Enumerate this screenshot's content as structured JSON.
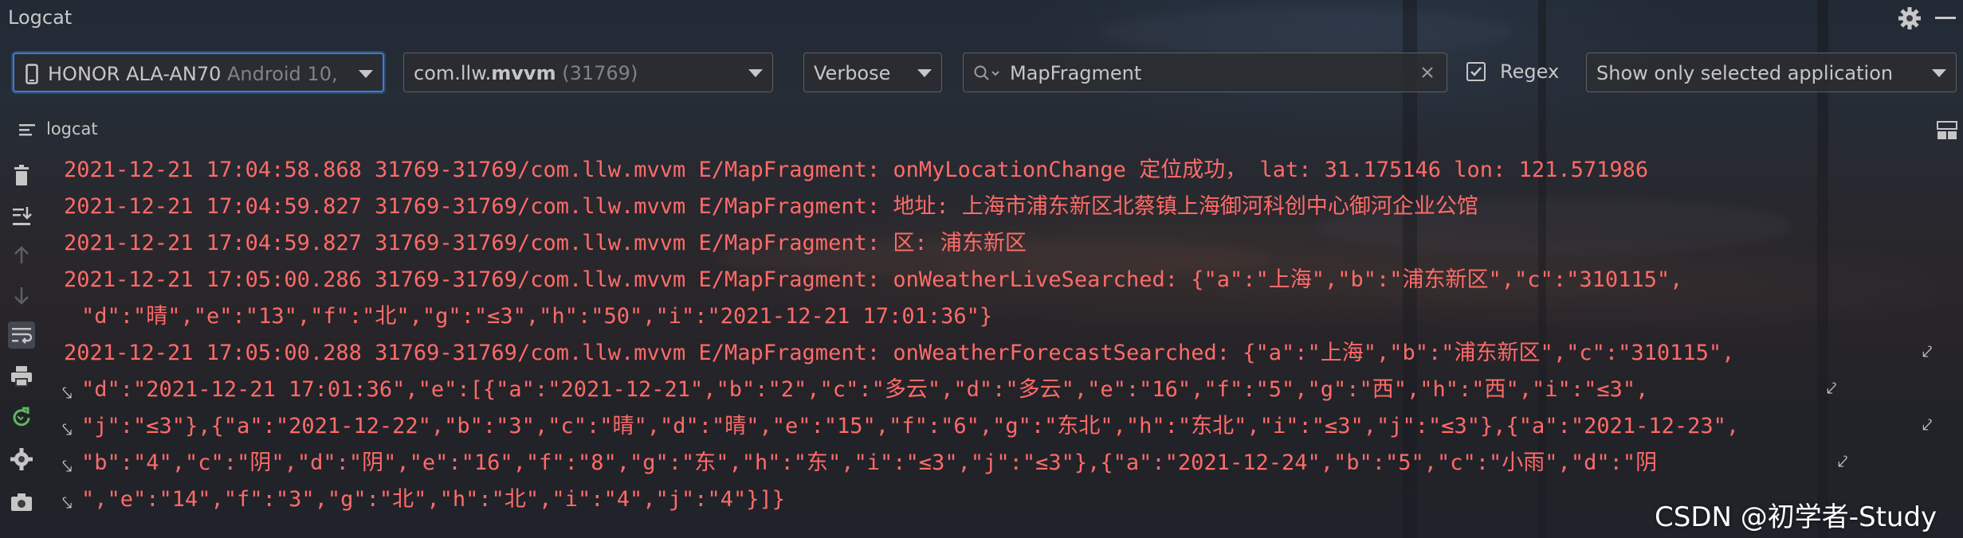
{
  "window": {
    "title": "Logcat"
  },
  "toolbar": {
    "device": {
      "name": "HONOR ALA-AN70",
      "os": "Android 10,"
    },
    "process": {
      "prefix": "com.llw.",
      "bold": "mvvm",
      "pid": "(31769)"
    },
    "level": "Verbose",
    "search": {
      "value": "MapFragment"
    },
    "regex": {
      "label": "Regex",
      "checked": true
    },
    "filter": "Show only selected application"
  },
  "panel": {
    "label": "logcat"
  },
  "sidebar": {
    "tools": [
      "trash-icon",
      "scroll-to-end-icon",
      "up-arrow-icon",
      "down-arrow-icon",
      "soft-wrap-icon",
      "print-icon",
      "restart-icon",
      "settings-icon",
      "camera-icon"
    ]
  },
  "log": {
    "lines": [
      "2021-12-21 17:04:58.868 31769-31769/com.llw.mvvm E/MapFragment: onMyLocationChange 定位成功， lat: 31.175146 lon: 121.571986",
      "2021-12-21 17:04:59.827 31769-31769/com.llw.mvvm E/MapFragment: 地址: 上海市浦东新区北蔡镇上海御河科创中心御河企业公馆",
      "2021-12-21 17:04:59.827 31769-31769/com.llw.mvvm E/MapFragment: 区: 浦东新区",
      "2021-12-21 17:05:00.286 31769-31769/com.llw.mvvm E/MapFragment: onWeatherLiveSearched: {\"a\":\"上海\",\"b\":\"浦东新区\",\"c\":\"310115\",",
      "\"d\":\"晴\",\"e\":\"13\",\"f\":\"北\",\"g\":\"≤3\",\"h\":\"50\",\"i\":\"2021-12-21 17:01:36\"}",
      "2021-12-21 17:05:00.288 31769-31769/com.llw.mvvm E/MapFragment: onWeatherForecastSearched: {\"a\":\"上海\",\"b\":\"浦东新区\",\"c\":\"310115\",",
      "\"d\":\"2021-12-21 17:01:36\",\"e\":[{\"a\":\"2021-12-21\",\"b\":\"2\",\"c\":\"多云\",\"d\":\"多云\",\"e\":\"16\",\"f\":\"5\",\"g\":\"西\",\"h\":\"西\",\"i\":\"≤3\",",
      "\"j\":\"≤3\"},{\"a\":\"2021-12-22\",\"b\":\"3\",\"c\":\"晴\",\"d\":\"晴\",\"e\":\"15\",\"f\":\"6\",\"g\":\"东北\",\"h\":\"东北\",\"i\":\"≤3\",\"j\":\"≤3\"},{\"a\":\"2021-12-23\",",
      "\"b\":\"4\",\"c\":\"阴\",\"d\":\"阴\",\"e\":\"16\",\"f\":\"8\",\"g\":\"东\",\"h\":\"东\",\"i\":\"≤3\",\"j\":\"≤3\"},{\"a\":\"2021-12-24\",\"b\":\"5\",\"c\":\"小雨\",\"d\":\"阴",
      "\",\"e\":\"14\",\"f\":\"3\",\"g\":\"北\",\"h\":\"北\",\"i\":\"4\",\"j\":\"4\"}]}"
    ],
    "color": "#ff6b68"
  },
  "watermark": "CSDN @初学者-Study"
}
